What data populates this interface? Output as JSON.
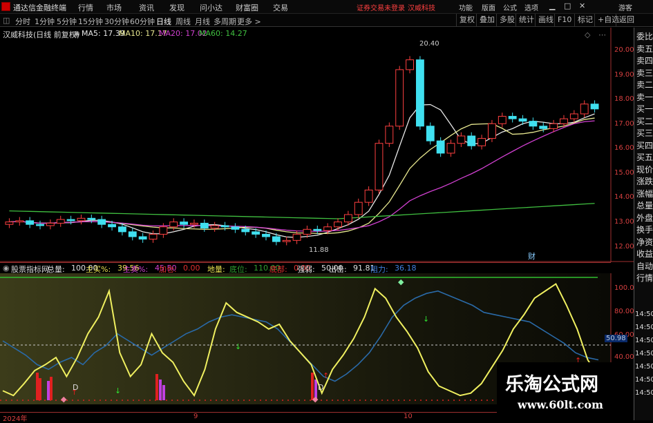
{
  "menubar": {
    "app_title": "通达信金融终端",
    "menus": [
      "行情",
      "市场",
      "资讯",
      "发现",
      "问小达",
      "财富圈",
      "交易"
    ],
    "notice": "证券交易未登录",
    "stock_name": "汉威科技",
    "right_menus": [
      "功能",
      "版面",
      "公式",
      "选项"
    ],
    "guest": "游客",
    "window_controls": [
      "minimize-icon",
      "maximize-icon",
      "close-icon"
    ]
  },
  "periodbar": {
    "periods": [
      "分时",
      "1分钟",
      "5分钟",
      "15分钟",
      "30分钟",
      "60分钟",
      "日线",
      "周线",
      "月线",
      "多周期",
      "更多 >"
    ],
    "selected": "日线",
    "right_buttons": [
      "复权",
      "叠加",
      "多股",
      "统计",
      "画线",
      "F10",
      "标记",
      "+自选",
      "返回"
    ]
  },
  "main_chart": {
    "stock_label": "汉威科技(日线 前复权)",
    "ma": [
      {
        "label": "MA5: 17.39",
        "color": "#e8e8e8"
      },
      {
        "label": "MA10: 17.17",
        "color": "#e8e890"
      },
      {
        "label": "MA20: 17.02",
        "color": "#d040d0"
      },
      {
        "label": "MA60: 14.27",
        "color": "#40c040"
      }
    ],
    "price_ticks": [
      "20.00",
      "19.00",
      "18.00",
      "17.00",
      "16.00",
      "15.00",
      "14.00",
      "13.00",
      "12.00"
    ],
    "high_label": "20.40",
    "low_label": "11.88",
    "marker": "财"
  },
  "indicator": {
    "name": "股票指标网",
    "fields": [
      {
        "label": "总量:",
        "value": "100.00",
        "color": "#e0e0e0"
      },
      {
        "label": "主买%:",
        "value": "39.56",
        "color": "#e8e050"
      },
      {
        "label": "主卖%:",
        "value": "45.50",
        "color": "#d040d0"
      },
      {
        "label": "加仓:",
        "value": "0.00",
        "color": "#e03030"
      },
      {
        "label": "地量:",
        "value": "",
        "color": "#e8e050"
      },
      {
        "label": "底位:",
        "value": "110.00",
        "color": "#30a030"
      },
      {
        "label": "底部:",
        "value": "0.00",
        "color": "#e03030"
      },
      {
        "label": "强弱:",
        "value": "50.00",
        "color": "#e0e0e0"
      },
      {
        "label": "出击:",
        "value": "91.81",
        "color": "#e0e0e0"
      },
      {
        "label": "阻力:",
        "value": "36.18",
        "color": "#4080e0"
      }
    ],
    "ticks": [
      "100.0",
      "80.00",
      "60.00",
      "40.00"
    ],
    "current_value": "50.98",
    "d_labels": [
      "D",
      "D"
    ]
  },
  "dates": [
    "2024年",
    "9",
    "10"
  ],
  "rightcol": [
    "委比",
    "卖五",
    "卖四",
    "卖三",
    "卖二",
    "卖一",
    "买一",
    "买二",
    "买三",
    "买四",
    "买五",
    "现价",
    "涨跌",
    "涨幅",
    "总量",
    "外盘",
    "换手",
    "净资",
    "收益",
    "自动",
    "行情",
    "14:50",
    "14:50",
    "14:50",
    "14:50",
    "14:50",
    "14:50",
    "14:50"
  ],
  "watermark": {
    "title": "乐淘公式网",
    "url": "www.60lt.com"
  }
}
